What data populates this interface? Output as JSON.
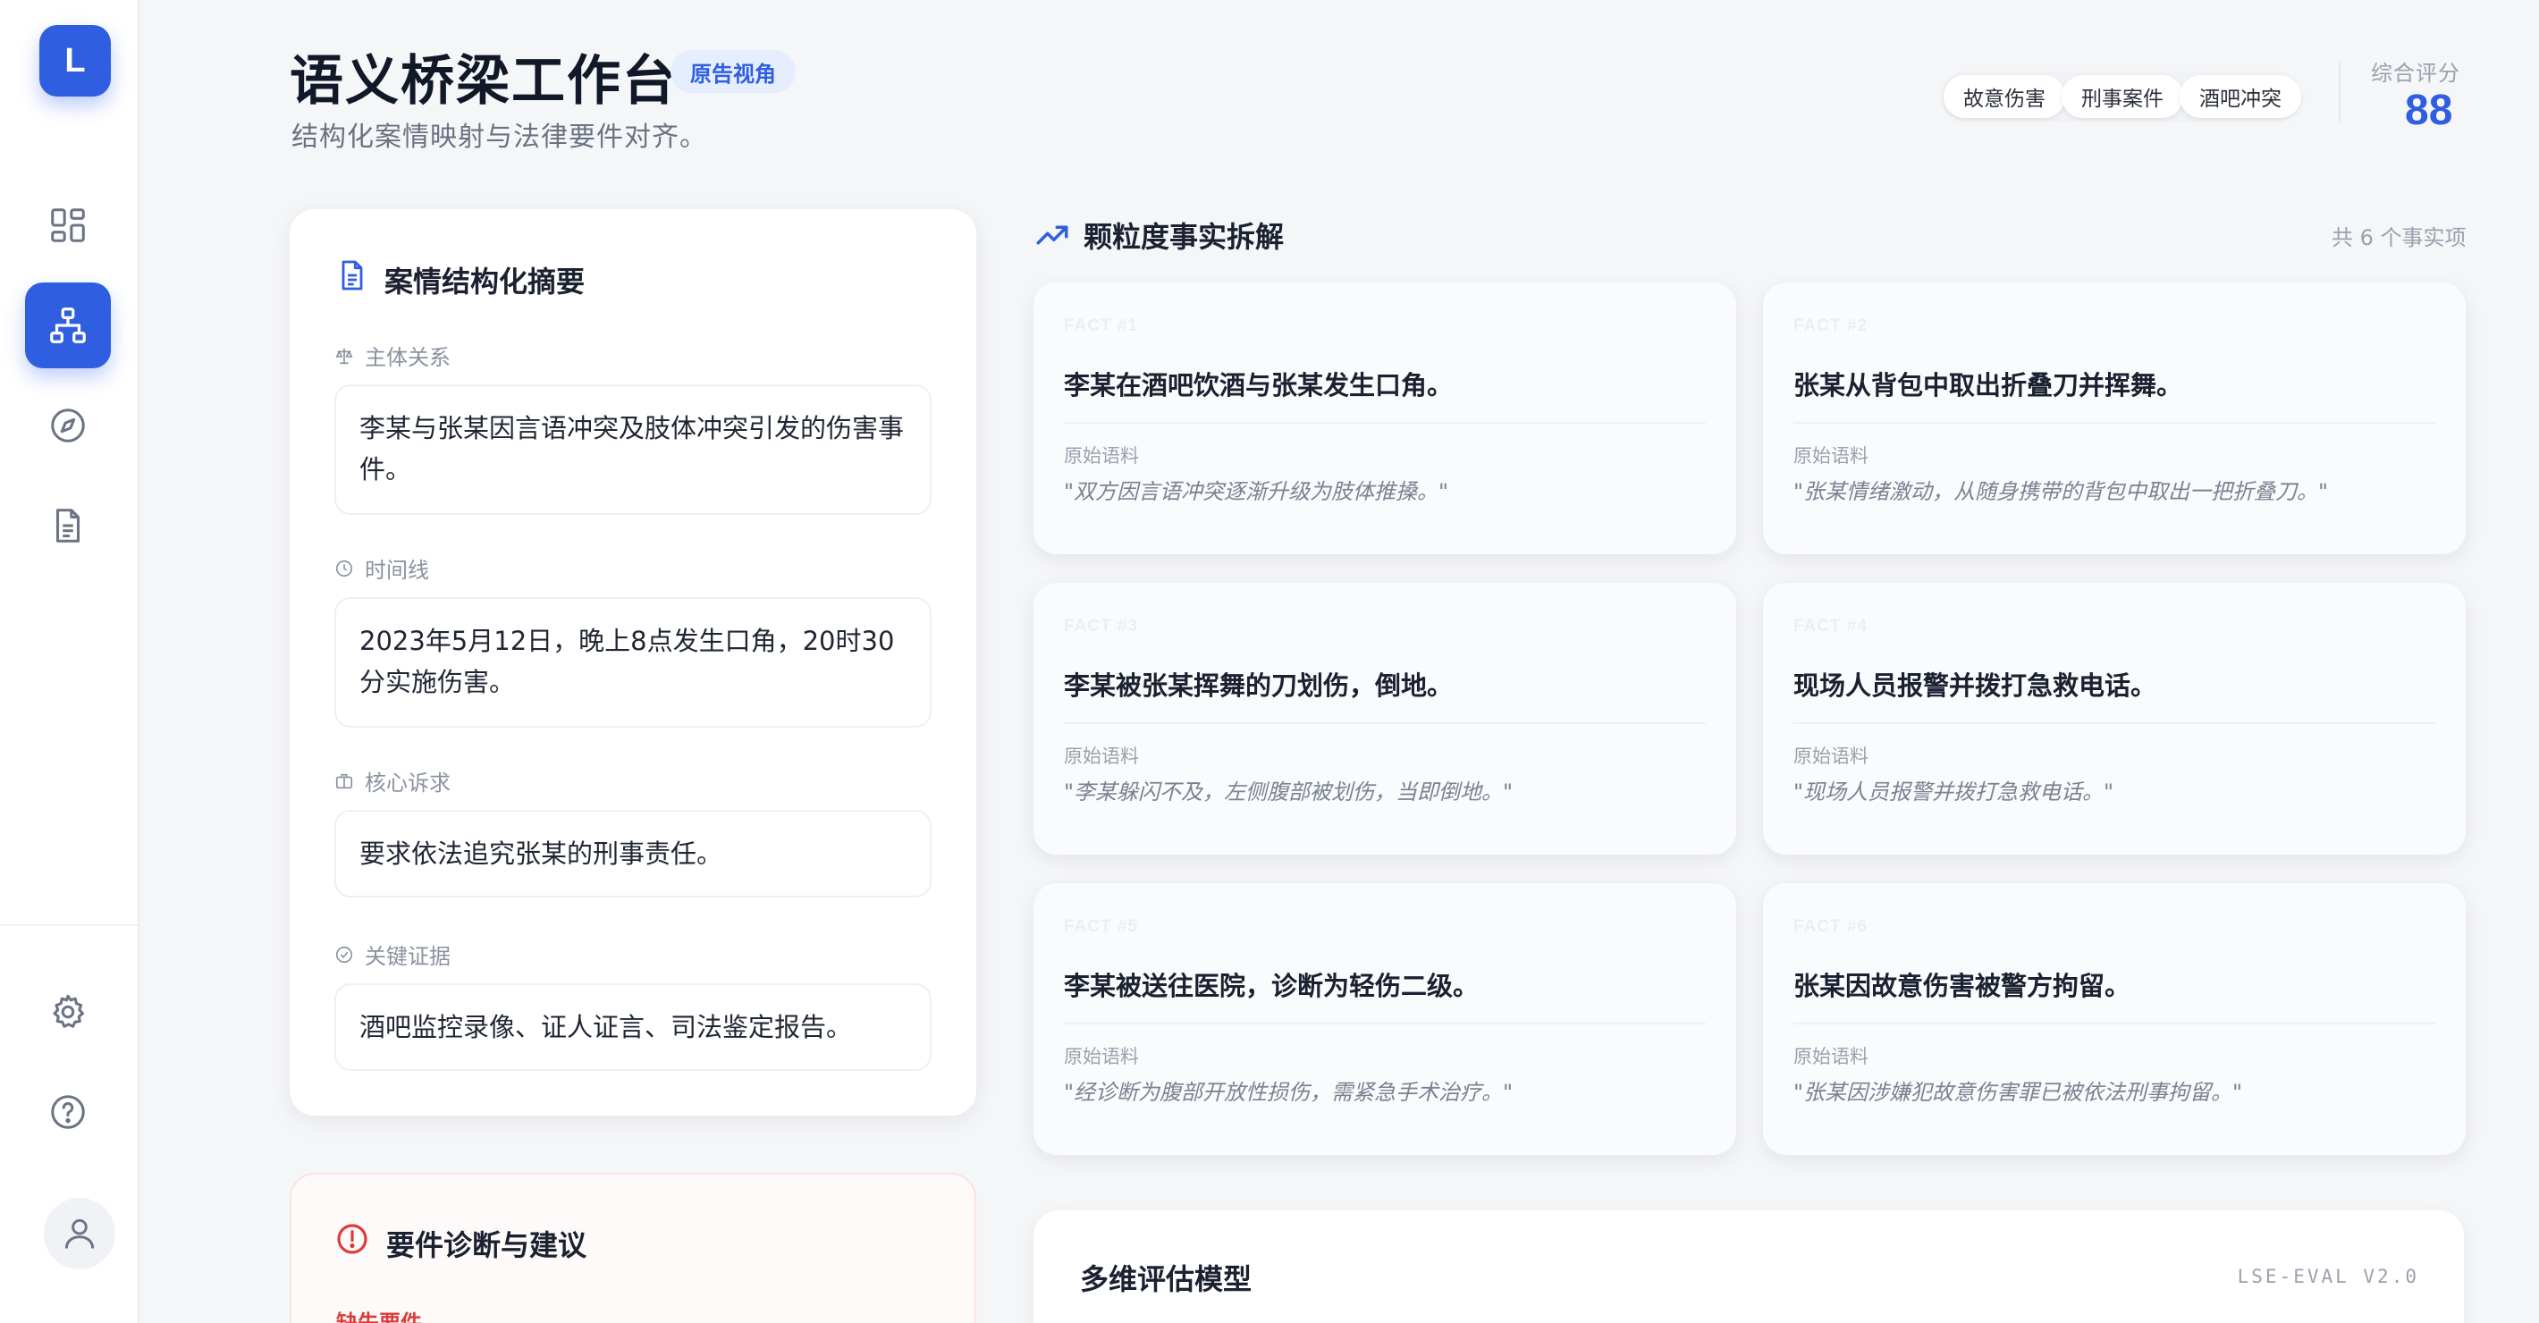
{
  "app": {
    "logo_letter": "L"
  },
  "sidebar": {
    "items": [
      {
        "name": "dashboard",
        "icon": "grid-icon",
        "active": false
      },
      {
        "name": "hierarchy",
        "icon": "hierarchy-icon",
        "active": true
      },
      {
        "name": "explore",
        "icon": "compass-icon",
        "active": false
      },
      {
        "name": "documents",
        "icon": "document-icon",
        "active": false
      }
    ],
    "bottom_items": [
      {
        "name": "settings",
        "icon": "gear-icon"
      },
      {
        "name": "help",
        "icon": "help-circle-icon"
      }
    ],
    "avatar_icon": "user-icon"
  },
  "header": {
    "title": "语义桥梁工作台",
    "badge": "原告视角",
    "subtitle": "结构化案情映射与法律要件对齐。",
    "tags": [
      "故意伤害",
      "刑事案件",
      "酒吧冲突"
    ],
    "score_label": "综合评分",
    "score_value": "88"
  },
  "summary": {
    "title": "案情结构化摘要",
    "sections": [
      {
        "label": "主体关系",
        "icon": "scale-icon",
        "value": "李某与张某因言语冲突及肢体冲突引发的伤害事件。"
      },
      {
        "label": "时间线",
        "icon": "clock-icon",
        "value": "2023年5月12日，晚上8点发生口角，20时30分实施伤害。"
      },
      {
        "label": "核心诉求",
        "icon": "briefcase-icon",
        "value": "要求依法追究张某的刑事责任。"
      },
      {
        "label": "关键证据",
        "icon": "check-circle-icon",
        "value": "酒吧监控录像、证人证言、司法鉴定报告。"
      }
    ]
  },
  "diagnosis": {
    "title": "要件诊断与建议",
    "subheading": "缺失要件"
  },
  "facts": {
    "title": "颗粒度事实拆解",
    "count_text": "共 6 个事实项",
    "source_label": "原始语料",
    "items": [
      {
        "num": "FACT #1",
        "text": "李某在酒吧饮酒与张某发生口角。",
        "quote": "\"双方因言语冲突逐渐升级为肢体推搡。\""
      },
      {
        "num": "FACT #2",
        "text": "张某从背包中取出折叠刀并挥舞。",
        "quote": "\"张某情绪激动，从随身携带的背包中取出一把折叠刀。\""
      },
      {
        "num": "FACT #3",
        "text": "李某被张某挥舞的刀划伤，倒地。",
        "quote": "\"李某躲闪不及，左侧腹部被划伤，当即倒地。\""
      },
      {
        "num": "FACT #4",
        "text": "现场人员报警并拨打急救电话。",
        "quote": "\"现场人员报警并拨打急救电话。\""
      },
      {
        "num": "FACT #5",
        "text": "李某被送往医院，诊断为轻伤二级。",
        "quote": "\"经诊断为腹部开放性损伤，需紧急手术治疗。\""
      },
      {
        "num": "FACT #6",
        "text": "张某因故意伤害被警方拘留。",
        "quote": "\"张某因涉嫌犯故意伤害罪已被依法刑事拘留。\""
      }
    ]
  },
  "evaluation": {
    "title": "多维评估模型",
    "version": "LSE-EVAL V2.0"
  },
  "colors": {
    "accent": "#2f5fe0",
    "danger": "#dc3b3b",
    "background": "#f5f6f8"
  }
}
